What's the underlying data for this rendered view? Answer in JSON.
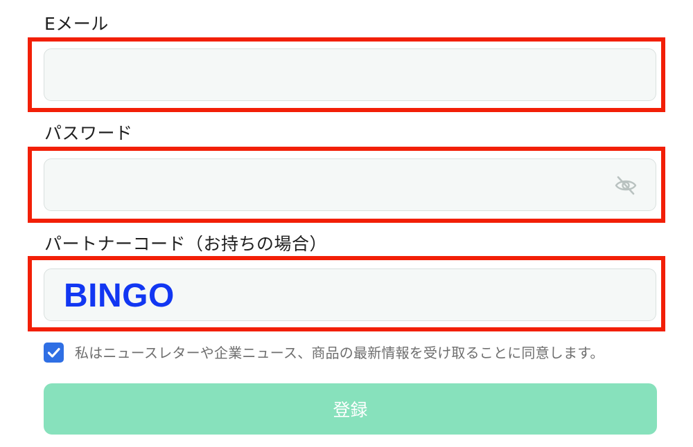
{
  "form": {
    "email": {
      "label": "Eメール",
      "value": ""
    },
    "password": {
      "label": "パスワード",
      "value": "",
      "toggle_icon": "eye-slash-icon"
    },
    "partner_code": {
      "label": "パートナーコード（お持ちの場合）",
      "value": ""
    },
    "consent": {
      "checked": true,
      "text": "私はニュースレターや企業ニュース、商品の最新情報を受け取ることに同意します。"
    },
    "submit_label": "登録"
  },
  "annotation": {
    "text": "BINGO",
    "color": "#1237f2",
    "highlight_color": "#f21f07"
  },
  "colors": {
    "accent_button": "#87e1bc",
    "checkbox": "#2f6fe4",
    "field_bg": "#f5f8f7"
  }
}
